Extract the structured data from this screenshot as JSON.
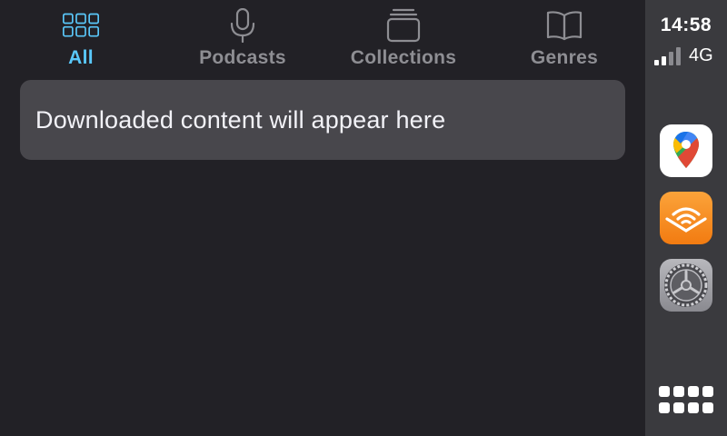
{
  "tabs": [
    {
      "label": "All",
      "icon": "grid-icon",
      "active": true
    },
    {
      "label": "Podcasts",
      "icon": "microphone-icon",
      "active": false
    },
    {
      "label": "Collections",
      "icon": "stack-icon",
      "active": false
    },
    {
      "label": "Genres",
      "icon": "book-icon",
      "active": false
    }
  ],
  "content": {
    "empty_message": "Downloaded content will appear here"
  },
  "status": {
    "time": "14:58",
    "network": "4G",
    "signal_bars_filled": 2,
    "signal_bars_total": 4
  },
  "dock": {
    "apps": [
      {
        "name": "Google Maps",
        "icon": "google-maps-icon"
      },
      {
        "name": "Audible",
        "icon": "audible-icon"
      },
      {
        "name": "Settings",
        "icon": "settings-gear-icon"
      }
    ],
    "home_icon": "app-grid-icon"
  },
  "colors": {
    "accent": "#5ac8fa",
    "inactive": "#8e8e93",
    "background": "#222126",
    "card": "#48474c",
    "sidebar": "#3a3a3e"
  }
}
